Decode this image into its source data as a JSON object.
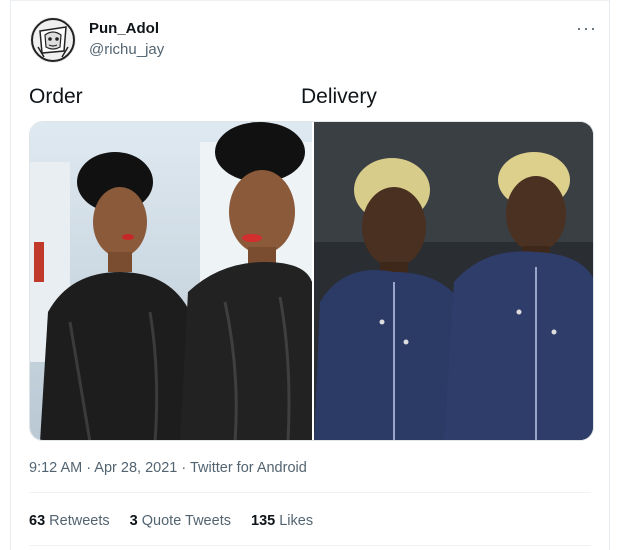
{
  "tweet": {
    "display_name": "Pun_Adol",
    "handle": "@richu_jay",
    "more_glyph": "···",
    "captions": {
      "left": "Order",
      "right": "Delivery"
    },
    "meta": "9:12 AM · Apr 28, 2021 · Twitter for Android",
    "stats": [
      {
        "count": "63",
        "label": "Retweets"
      },
      {
        "count": "3",
        "label": "Quote Tweets"
      },
      {
        "count": "135",
        "label": "Likes"
      }
    ]
  }
}
